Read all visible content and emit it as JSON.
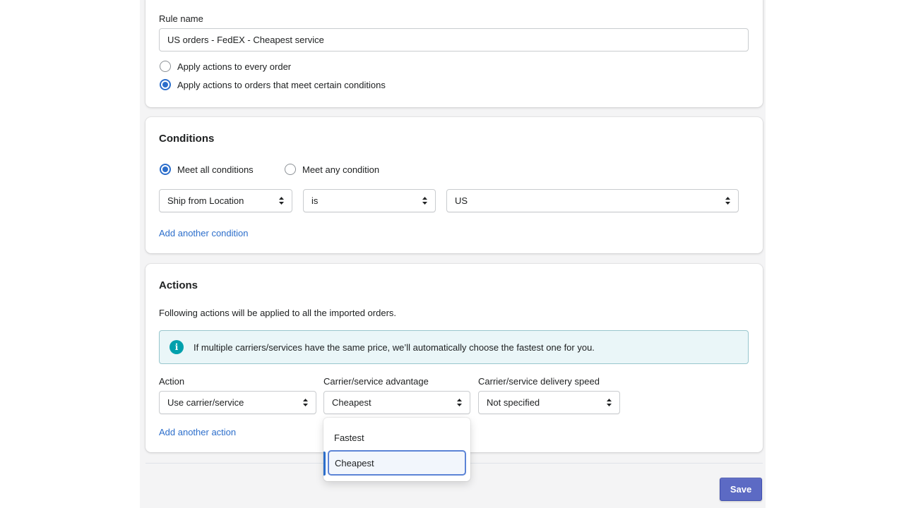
{
  "rule": {
    "name_label": "Rule name",
    "name_value": "US orders - FedEX - Cheapest service",
    "apply_options": [
      {
        "label": "Apply actions to every order",
        "checked": false
      },
      {
        "label": "Apply actions to orders that meet certain conditions",
        "checked": true
      }
    ]
  },
  "conditions": {
    "title": "Conditions",
    "match_options": [
      {
        "label": "Meet all conditions",
        "checked": true
      },
      {
        "label": "Meet any condition",
        "checked": false
      }
    ],
    "row": {
      "field": "Ship from Location",
      "operator": "is",
      "value": "US"
    },
    "add_link": "Add another condition"
  },
  "actions": {
    "title": "Actions",
    "description": "Following actions will be applied to all the imported orders.",
    "banner": "If multiple carriers/services have the same price, we’ll automatically choose the fastest one for you.",
    "columns": {
      "action_label": "Action",
      "advantage_label": "Carrier/service advantage",
      "speed_label": "Carrier/service delivery speed"
    },
    "values": {
      "action": "Use carrier/service",
      "advantage": "Cheapest",
      "speed": "Not specified"
    },
    "add_link": "Add another action",
    "dropdown_options": [
      "Fastest",
      "Cheapest"
    ],
    "dropdown_selected": "Cheapest"
  },
  "footer": {
    "save_label": "Save"
  },
  "colors": {
    "primary": "#5c6ac4",
    "link": "#2c6ecb",
    "info": "#00a0ac",
    "banner_bg": "#eaf6f8"
  }
}
